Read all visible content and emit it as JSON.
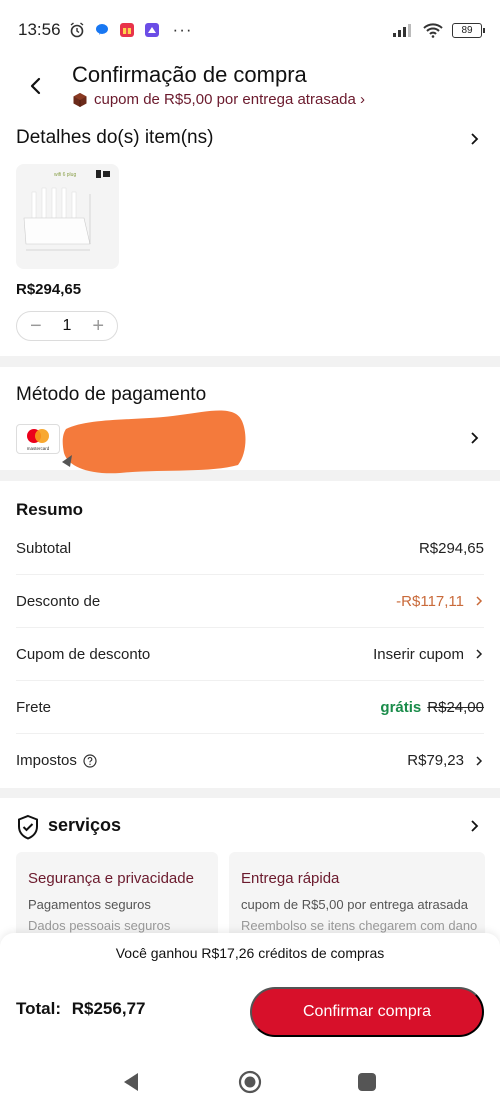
{
  "status_bar": {
    "time": "13:56",
    "battery": "89"
  },
  "header": {
    "title": "Confirmação de compra",
    "coupon_notice": "cupom de R$5,00 por entrega atrasada ›"
  },
  "items_section": {
    "title": "Detalhes do(s) item(ns)",
    "product": {
      "price": "R$294,65",
      "quantity": "1",
      "image_caption": "wifi 6 plug"
    }
  },
  "payment_section": {
    "title": "Método de pagamento",
    "card_brand": "mastercard"
  },
  "summary": {
    "title": "Resumo",
    "subtotal": {
      "label": "Subtotal",
      "value": "R$294,65"
    },
    "discount": {
      "label": "Desconto de",
      "value": "-R$117,11"
    },
    "coupon": {
      "label": "Cupom de desconto",
      "value": "Inserir cupom"
    },
    "shipping": {
      "label": "Frete",
      "free": "grátis",
      "original": "R$24,00"
    },
    "taxes": {
      "label": "Impostos",
      "value": "R$79,23"
    }
  },
  "services": {
    "title": "serviços",
    "cards": [
      {
        "title": "Segurança e privacidade",
        "line1": "Pagamentos seguros",
        "line2": "Dados pessoais seguros"
      },
      {
        "title": "Entrega rápida",
        "line1": "cupom de R$5,00 por entrega atrasada",
        "line2": "Reembolso se itens chegarem com dano"
      }
    ]
  },
  "bottom": {
    "credits": "Você ganhou R$17,26 créditos de compras",
    "total_label": "Total:",
    "total_value": "R$256,77",
    "confirm_label": "Confirmar compra"
  },
  "colors": {
    "brand_red": "#d7102a",
    "discount_orange": "#c96a3a",
    "free_green": "#1a8c4a",
    "coupon_maroon": "#6b1a2d"
  },
  "icons": [
    "alarm-icon",
    "messenger-icon",
    "gift-icon",
    "app-icon",
    "signal-icon",
    "wifi-icon",
    "battery-icon",
    "back-arrow-icon",
    "chevron-right-icon",
    "box-icon",
    "help-circle-icon",
    "shield-check-icon",
    "nav-back-icon",
    "nav-home-icon",
    "nav-recents-icon"
  ]
}
